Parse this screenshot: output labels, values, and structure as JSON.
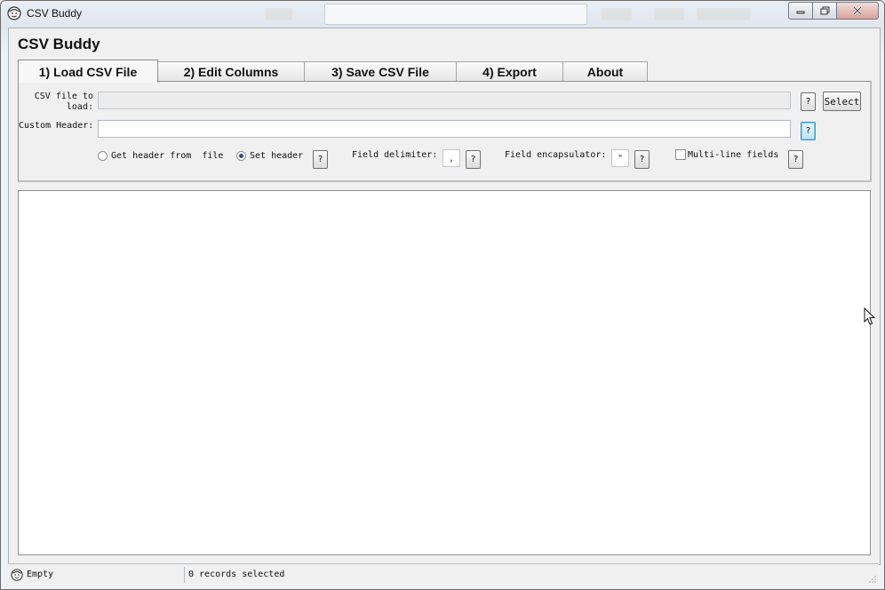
{
  "window": {
    "title": "CSV Buddy"
  },
  "app": {
    "heading": "CSV Buddy"
  },
  "tabs": [
    {
      "label": "1) Load CSV File",
      "active": true
    },
    {
      "label": "2) Edit Columns",
      "active": false
    },
    {
      "label": "3) Save CSV File",
      "active": false
    },
    {
      "label": "4) Export",
      "active": false
    },
    {
      "label": "About",
      "active": false
    }
  ],
  "load": {
    "file_label_line1": "CSV file to",
    "file_label_line2": "load:",
    "file_value": "",
    "help": "?",
    "select_label": "Select",
    "header_label": "Custom Header:",
    "header_value": "",
    "radio_file_label": "Get header from  file",
    "radio_set_label": "Set header",
    "header_mode": "set",
    "delimiter_label": "Field delimiter:",
    "delimiter_value": ",",
    "encapsulator_label": "Field encapsulator:",
    "encapsulator_value": "\"",
    "multiline_label": "Multi-line fields",
    "multiline_checked": false
  },
  "status": {
    "left": "Empty",
    "right": "0 records selected"
  },
  "icons": {
    "app": "face-icon",
    "minimize": "minimize-icon",
    "maximize": "maximize-icon",
    "close": "close-icon",
    "cursor": "mouse-pointer-icon"
  }
}
